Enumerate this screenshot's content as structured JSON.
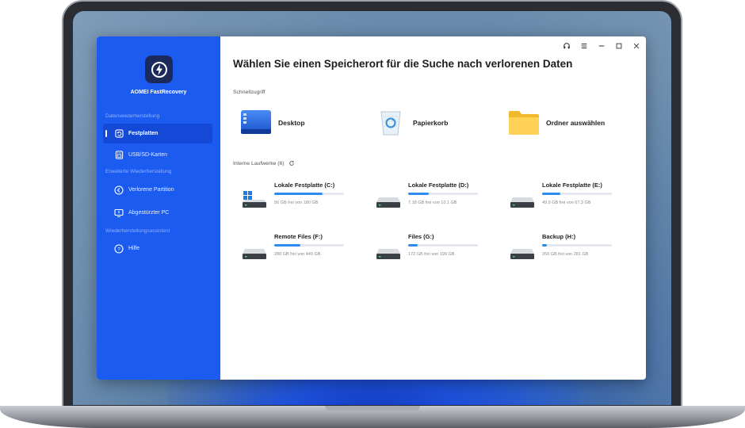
{
  "app": {
    "name": "AOMEI FastRecovery",
    "window_controls": [
      "headset-icon",
      "menu-icon",
      "minimize-icon",
      "maximize-icon",
      "close-icon"
    ]
  },
  "sidebar": {
    "groups": [
      {
        "label": "Datenwiederherstellung",
        "items": [
          {
            "label": "Festplatten",
            "icon": "restore-icon",
            "active": true
          },
          {
            "label": "USB/SD-Karten",
            "icon": "sd-card-icon",
            "active": false
          }
        ]
      },
      {
        "label": "Erweiterte Wiederherstellung",
        "items": [
          {
            "label": "Verlorene Partition",
            "icon": "partition-icon",
            "active": false
          },
          {
            "label": "Abgestürzter PC",
            "icon": "monitor-icon",
            "active": false
          }
        ]
      },
      {
        "label": "Wiederherstellungsassistent",
        "items": [
          {
            "label": "Hilfe",
            "icon": "help-icon",
            "active": false
          }
        ]
      }
    ]
  },
  "main": {
    "title": "Wählen Sie einen Speicherort für die Suche nach verlorenen Daten",
    "quick_access_label": "Schnellzugriff",
    "quick_access": [
      {
        "label": "Desktop",
        "icon": "desktop-icon"
      },
      {
        "label": "Papierkorb",
        "icon": "recycle-bin-icon"
      },
      {
        "label": "Ordner auswählen",
        "icon": "folder-icon"
      }
    ],
    "drives_label": "Interne Laufwerke (6)",
    "drives": [
      {
        "name": "Lokale Festplatte (C:)",
        "size": "56 GB frei von 180 GB",
        "used_fraction": 0.69,
        "system": true
      },
      {
        "name": "Lokale Festplatte (D:)",
        "size": "7.18 GB frei von 10.1 GB",
        "used_fraction": 0.29,
        "system": false
      },
      {
        "name": "Lokale Festplatte (E:)",
        "size": "49.9 GB frei von 67.3 GB",
        "used_fraction": 0.26,
        "system": false
      },
      {
        "name": "Remote Files (F:)",
        "size": "280 GB frei von 449 GB",
        "used_fraction": 0.38,
        "system": false
      },
      {
        "name": "Files (G:)",
        "size": "172 GB frei von 199 GB",
        "used_fraction": 0.14,
        "system": false
      },
      {
        "name": "Backup (H:)",
        "size": "260 GB frei von 281 GB",
        "used_fraction": 0.07,
        "system": false
      }
    ]
  },
  "colors": {
    "sidebar": "#1c5bf0",
    "sidebar_active": "#1448d6",
    "progress": "#2d8cf0"
  }
}
